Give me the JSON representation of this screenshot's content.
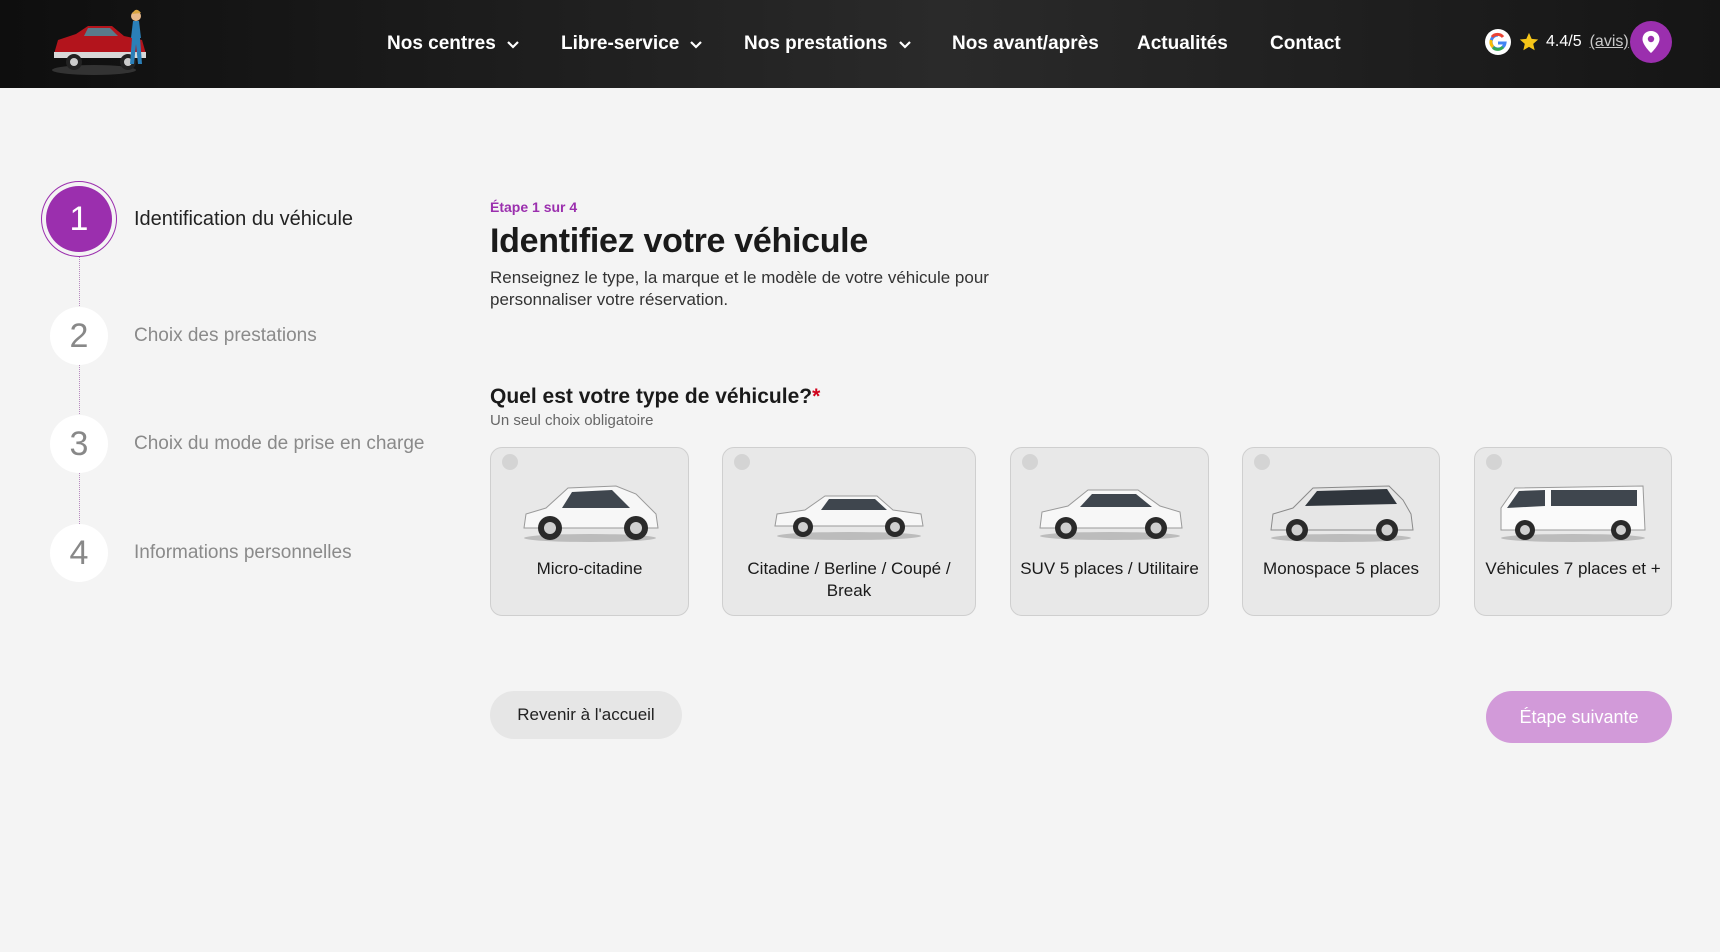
{
  "header": {
    "logo_icon": "vintage-car-logo",
    "nav": [
      {
        "label": "Nos centres",
        "has_dropdown": true
      },
      {
        "label": "Libre-service",
        "has_dropdown": true
      },
      {
        "label": "Nos prestations",
        "has_dropdown": true
      },
      {
        "label": "Nos avant/après",
        "has_dropdown": false
      },
      {
        "label": "Actualités",
        "has_dropdown": false
      },
      {
        "label": "Contact",
        "has_dropdown": false
      }
    ],
    "rating": {
      "score": "4.4/5",
      "link_label": "(avis)",
      "icon": "google-icon"
    },
    "location_icon": "map-pin-icon"
  },
  "steps": [
    {
      "number": "1",
      "label": "Identification du véhicule",
      "active": true
    },
    {
      "number": "2",
      "label": "Choix des prestations",
      "active": false
    },
    {
      "number": "3",
      "label": "Choix du mode de prise en charge",
      "active": false
    },
    {
      "number": "4",
      "label": "Informations personnelles",
      "active": false
    }
  ],
  "main": {
    "step_indicator": "Étape 1 sur 4",
    "title": "Identifiez votre véhicule",
    "description": "Renseignez le type, la marque et le modèle de votre véhicule pour personnaliser votre réservation.",
    "question": "Quel est votre type de véhicule?",
    "required_mark": "*",
    "question_hint": "Un seul choix obligatoire"
  },
  "vehicle_types": [
    {
      "label": "Micro-citadine",
      "icon": "micro-car-icon"
    },
    {
      "label": "Citadine / Berline / Coupé / Break",
      "icon": "sedan-icon"
    },
    {
      "label": "SUV 5 places / Utilitaire",
      "icon": "suv-icon"
    },
    {
      "label": "Monospace 5 places",
      "icon": "minivan-icon"
    },
    {
      "label": "Véhicules 7 places et +",
      "icon": "van-icon"
    }
  ],
  "actions": {
    "back_label": "Revenir à l'accueil",
    "next_label": "Étape suivante"
  },
  "colors": {
    "accent": "#9b2fae",
    "accent_disabled": "#d29ad9",
    "header_bg": "#1a1a1a",
    "page_bg": "#f4f4f4"
  }
}
